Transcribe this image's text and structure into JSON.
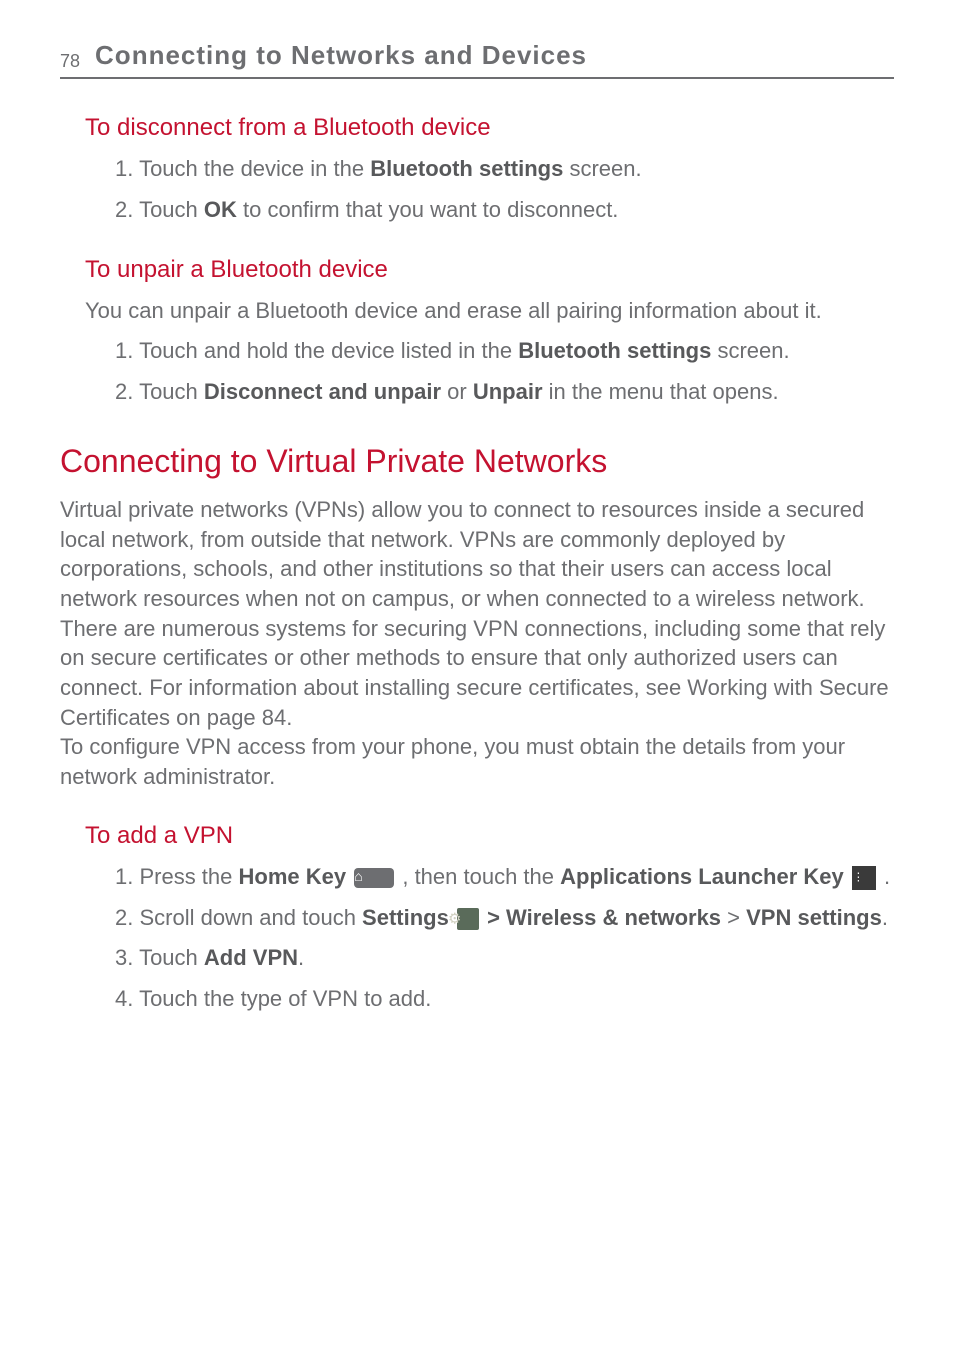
{
  "header": {
    "page_number": "78",
    "title": "Connecting to Networks and Devices"
  },
  "section1": {
    "heading": "To disconnect from a Bluetooth device",
    "item1_pre": "1. Touch the device in the ",
    "item1_bold": "Bluetooth settings",
    "item1_post": " screen.",
    "item2_pre": "2. Touch ",
    "item2_bold": "OK",
    "item2_post": " to confirm that you want to disconnect."
  },
  "section2": {
    "heading": "To unpair a Bluetooth device",
    "body": "You can unpair a Bluetooth device and erase all pairing information about it.",
    "item1_pre": "1. Touch and hold the device listed in the ",
    "item1_bold": "Bluetooth settings",
    "item1_post": " screen.",
    "item2_pre": "2. Touch ",
    "item2_bold1": "Disconnect and unpair",
    "item2_mid": " or ",
    "item2_bold2": "Unpair",
    "item2_post": " in the menu that opens."
  },
  "section3": {
    "heading": "Connecting to Virtual Private Networks",
    "body1": "Virtual private networks (VPNs) allow you to connect to resources inside a secured local network, from outside that network. VPNs are commonly deployed by corporations, schools, and other institutions so that their users can access local network resources when not on campus, or when connected to a wireless network.",
    "body2": "There are numerous systems for securing VPN connections, including some that rely on secure certificates or other methods to ensure that only authorized users can connect. For information about installing secure certificates, see Working with Secure Certificates on page 84.",
    "body3": "To configure VPN access from your phone, you must obtain the details from your network administrator."
  },
  "section4": {
    "heading": "To add a VPN",
    "item1_pre": "1. Press the ",
    "item1_bold1": "Home Key",
    "item1_mid": " , then touch the ",
    "item1_bold2": "Applications Launcher Key",
    "item1_post": " .",
    "item2_pre": "2. Scroll down and touch ",
    "item2_bold1": "Settings",
    "item2_mid1": " > ",
    "item2_bold2": "Wireless & networks",
    "item2_mid2": " > ",
    "item2_bold3": "VPN settings",
    "item2_post": ".",
    "item3_pre": "3. Touch ",
    "item3_bold": "Add VPN",
    "item3_post": ".",
    "item4": "4. Touch the type of VPN to add."
  }
}
